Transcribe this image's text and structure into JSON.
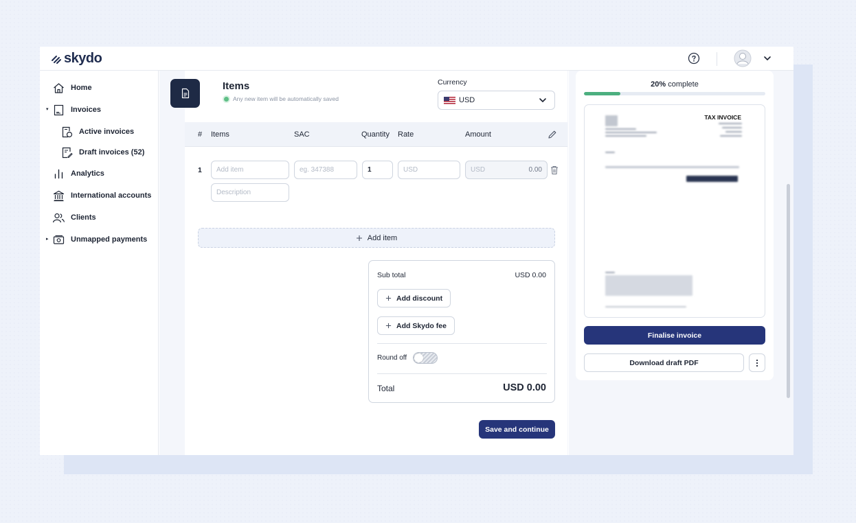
{
  "app": {
    "brand": "skydo"
  },
  "sidebar": {
    "items": [
      {
        "label": "Home",
        "icon": "home-icon"
      },
      {
        "label": "Invoices",
        "icon": "invoice-icon"
      },
      {
        "label": "Active invoices",
        "icon": "active-invoice-icon"
      },
      {
        "label": "Draft invoices (52)",
        "icon": "draft-invoice-icon"
      },
      {
        "label": "Analytics",
        "icon": "analytics-icon"
      },
      {
        "label": "International accounts",
        "icon": "bank-icon"
      },
      {
        "label": "Clients",
        "icon": "clients-icon"
      },
      {
        "label": "Unmapped payments",
        "icon": "payment-icon"
      }
    ]
  },
  "items_section": {
    "title": "Items",
    "autosave_note": "Any new item will be automatically saved",
    "currency_label": "Currency",
    "currency_value": "USD",
    "columns": [
      "#",
      "Items",
      "SAC",
      "Quantity",
      "Rate",
      "Amount"
    ],
    "row": {
      "number": "1",
      "item_placeholder": "Add item",
      "sac_placeholder": "eg. 347388",
      "quantity": "1",
      "rate_placeholder": "USD",
      "amount_currency": "USD",
      "amount_value": "0.00",
      "description_placeholder": "Description"
    },
    "add_item_label": "Add item"
  },
  "summary": {
    "sub_total_label": "Sub total",
    "sub_total_value": "USD 0.00",
    "add_discount_label": "Add discount",
    "add_fee_label": "Add Skydo fee",
    "round_off_label": "Round off",
    "round_off_on": false,
    "total_label": "Total",
    "total_value": "USD 0.00"
  },
  "save_label": "Save and continue",
  "preview": {
    "progress_percent": "20%",
    "progress_suffix": " complete",
    "progress_fraction": 0.2,
    "doc_title": "TAX INVOICE",
    "finalise_label": "Finalise invoice",
    "download_label": "Download draft PDF"
  },
  "colors": {
    "accent": "#26357a",
    "dark_tile": "#1e2a45",
    "progress": "#4caf7f",
    "status_dot": "#5fbf86"
  }
}
